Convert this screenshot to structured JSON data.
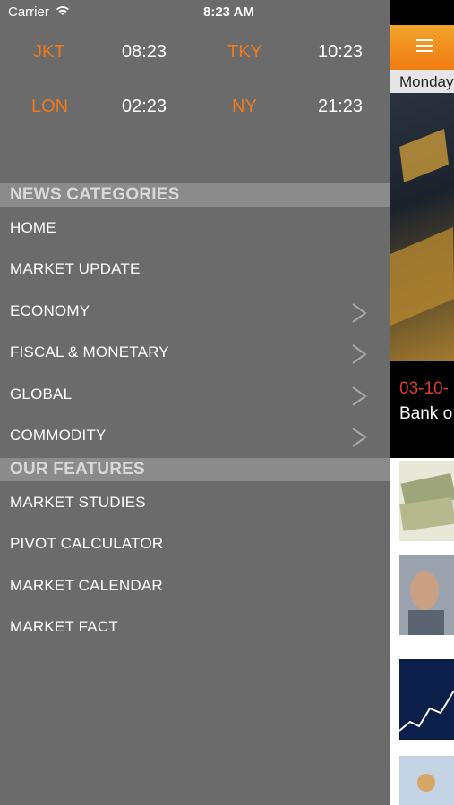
{
  "status_bar": {
    "carrier": "Carrier",
    "time": "8:23 AM"
  },
  "clocks": [
    {
      "city": "JKT",
      "time": "08:23"
    },
    {
      "city": "TKY",
      "time": "10:23"
    },
    {
      "city": "LON",
      "time": "02:23"
    },
    {
      "city": "NY",
      "time": "21:23"
    }
  ],
  "news_categories": {
    "header": "NEWS CATEGORIES",
    "items": [
      {
        "label": "HOME"
      },
      {
        "label": "MARKET UPDATE"
      },
      {
        "label": "ECONOMY"
      },
      {
        "label": "FISCAL & MONETARY"
      },
      {
        "label": "GLOBAL"
      },
      {
        "label": "COMMODITY"
      }
    ]
  },
  "our_features": {
    "header": "OUR FEATURES",
    "items": [
      {
        "label": "MARKET STUDIES"
      },
      {
        "label": "PIVOT CALCULATOR"
      },
      {
        "label": "MARKET CALENDAR"
      },
      {
        "label": "MARKET FACT"
      }
    ]
  },
  "main": {
    "date_text": "Monday",
    "hero_date": "03-10-",
    "hero_title": "Bank o"
  },
  "colors": {
    "accent": "#f07a1c",
    "navbar": "#f07c14"
  }
}
